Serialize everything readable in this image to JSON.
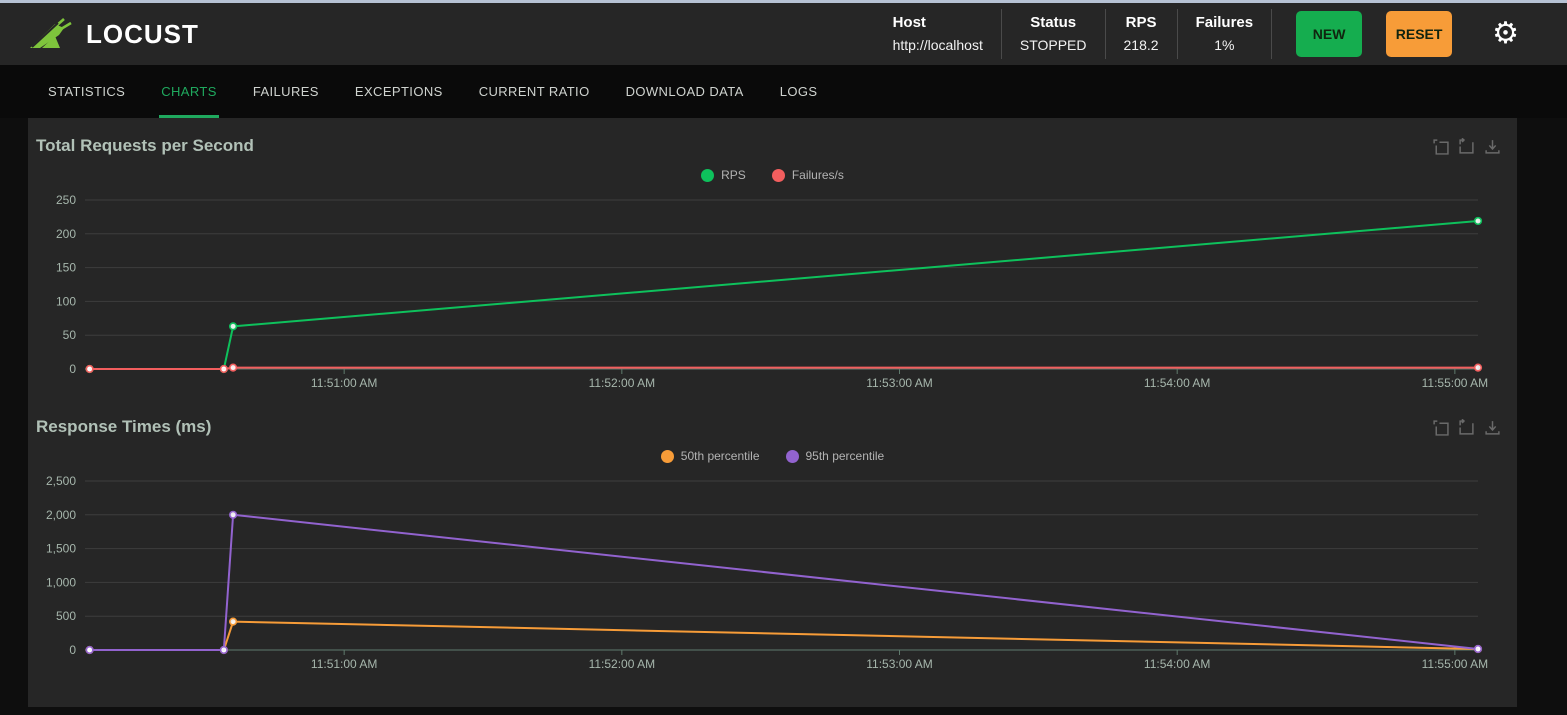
{
  "top_strip_color": "#b6c2d4",
  "header": {
    "logo_text": "LOCUST",
    "stats": [
      {
        "label": "Host",
        "value": "http://localhost"
      },
      {
        "label": "Status",
        "value": "STOPPED"
      },
      {
        "label": "RPS",
        "value": "218.2"
      },
      {
        "label": "Failures",
        "value": "1%"
      }
    ],
    "buttons": [
      {
        "label": "NEW",
        "color": "#15ad4f"
      },
      {
        "label": "RESET",
        "color": "#f79c38"
      }
    ],
    "settings_icon": "gear-icon",
    "settings_glyph": "⚙"
  },
  "tabs": [
    {
      "label": "STATISTICS",
      "active": false
    },
    {
      "label": "CHARTS",
      "active": true
    },
    {
      "label": "FAILURES",
      "active": false
    },
    {
      "label": "EXCEPTIONS",
      "active": false
    },
    {
      "label": "CURRENT RATIO",
      "active": false
    },
    {
      "label": "DOWNLOAD DATA",
      "active": false
    },
    {
      "label": "LOGS",
      "active": false
    }
  ],
  "colors": {
    "panel_bg": "#262626",
    "page_bg": "#0e0e0e",
    "accent_green": "#1fa95e",
    "grid": "#3d3d3d",
    "axis_line": "#5f7a6d",
    "tick_label": "#a6b6ac",
    "title": "#b1c1b7",
    "legend_text": "#b3b3b3",
    "toolbox_icon": "#6a6a6a"
  },
  "chart_data": [
    {
      "type": "line",
      "title": "Total Requests per Second",
      "legend_position": "top-center",
      "grid": true,
      "x_domain": [
        "11:50:04 AM",
        "11:55:05 AM"
      ],
      "x_ticks": [
        "11:51:00 AM",
        "11:52:00 AM",
        "11:53:00 AM",
        "11:54:00 AM",
        "11:55:00 AM"
      ],
      "ylim": [
        0,
        250
      ],
      "y_ticks": [
        {
          "v": 0,
          "label": "0"
        },
        {
          "v": 50,
          "label": "50"
        },
        {
          "v": 100,
          "label": "100"
        },
        {
          "v": 150,
          "label": "150"
        },
        {
          "v": 200,
          "label": "200"
        },
        {
          "v": 250,
          "label": "250"
        }
      ],
      "series": [
        {
          "name": "RPS",
          "color": "#0ec15c",
          "points": [
            [
              "11:50:05 AM",
              0
            ],
            [
              "11:50:34 AM",
              0
            ],
            [
              "11:50:36 AM",
              63
            ],
            [
              "11:55:05 AM",
              219
            ]
          ]
        },
        {
          "name": "Failures/s",
          "color": "#f25e5e",
          "points": [
            [
              "11:50:05 AM",
              0
            ],
            [
              "11:50:34 AM",
              0
            ],
            [
              "11:50:36 AM",
              2
            ],
            [
              "11:55:05 AM",
              2
            ]
          ]
        }
      ]
    },
    {
      "type": "line",
      "title": "Response Times (ms)",
      "legend_position": "top-center",
      "grid": true,
      "x_domain": [
        "11:50:04 AM",
        "11:55:05 AM"
      ],
      "x_ticks": [
        "11:51:00 AM",
        "11:52:00 AM",
        "11:53:00 AM",
        "11:54:00 AM",
        "11:55:00 AM"
      ],
      "ylim": [
        0,
        2500
      ],
      "y_ticks": [
        {
          "v": 0,
          "label": "0"
        },
        {
          "v": 500,
          "label": "500"
        },
        {
          "v": 1000,
          "label": "1,000"
        },
        {
          "v": 1500,
          "label": "1,500"
        },
        {
          "v": 2000,
          "label": "2,000"
        },
        {
          "v": 2500,
          "label": "2,500"
        }
      ],
      "series": [
        {
          "name": "50th percentile",
          "color": "#f79c38",
          "points": [
            [
              "11:50:05 AM",
              0
            ],
            [
              "11:50:34 AM",
              0
            ],
            [
              "11:50:36 AM",
              420
            ],
            [
              "11:55:05 AM",
              15
            ]
          ]
        },
        {
          "name": "95th percentile",
          "color": "#9263cf",
          "points": [
            [
              "11:50:05 AM",
              0
            ],
            [
              "11:50:34 AM",
              0
            ],
            [
              "11:50:36 AM",
              2000
            ],
            [
              "11:55:05 AM",
              15
            ]
          ]
        }
      ]
    }
  ],
  "toolbox_icons": [
    "data-zoom-icon",
    "restore-icon",
    "save-image-icon"
  ]
}
